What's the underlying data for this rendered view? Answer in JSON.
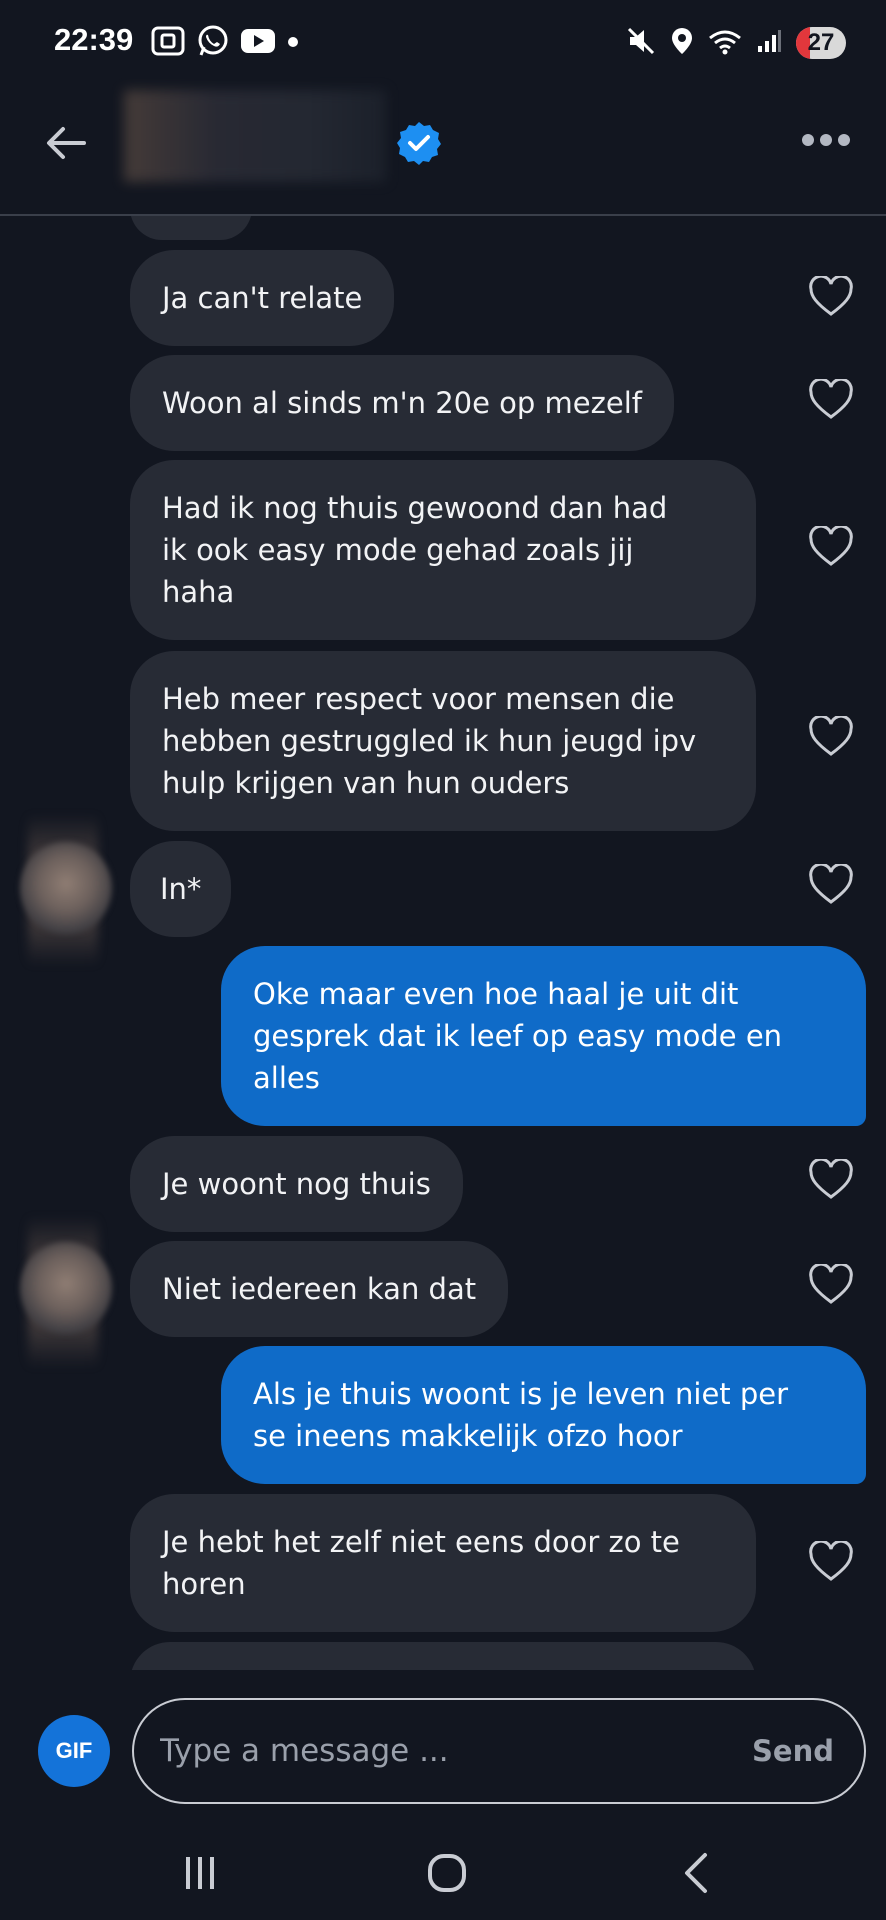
{
  "status_bar": {
    "time": "22:39",
    "battery": "27",
    "left_icons": [
      "screenshot-icon",
      "whatsapp-icon",
      "youtube-icon",
      "dot-icon"
    ],
    "right_icons": [
      "mute-icon",
      "location-icon",
      "wifi-icon",
      "signal-icon"
    ]
  },
  "header": {
    "contact_name": "",
    "verified": true,
    "icons": [
      "back-arrow-icon",
      "verified-badge-icon",
      "more-icon"
    ]
  },
  "messages": [
    {
      "id": "m1",
      "direction": "received",
      "text": "Ja can't relate",
      "liked": false
    },
    {
      "id": "m2",
      "direction": "received",
      "text": "Woon al sinds m'n 20e op mezelf",
      "liked": false
    },
    {
      "id": "m3",
      "direction": "received",
      "text": "Had ik nog thuis gewoond dan had\nik ook easy mode gehad zoals jij\nhaha",
      "liked": false
    },
    {
      "id": "m4",
      "direction": "received",
      "text": "Heb meer respect voor mensen die\nhebben gestruggled ik hun jeugd ipv\nhulp krijgen van hun ouders",
      "liked": false
    },
    {
      "id": "m5",
      "direction": "received",
      "text": "In*",
      "liked": false
    },
    {
      "id": "m6",
      "direction": "sent",
      "text": "Oke maar even hoe haal je uit dit\ngesprek dat ik leef op easy mode en\nalles"
    },
    {
      "id": "m7",
      "direction": "received",
      "text": "Je woont nog thuis",
      "liked": false
    },
    {
      "id": "m8",
      "direction": "received",
      "text": "Niet iedereen kan dat",
      "liked": false
    },
    {
      "id": "m9",
      "direction": "sent",
      "text": "Als je thuis woont is je leven niet per\nse ineens makkelijk ofzo hoor"
    },
    {
      "id": "m10",
      "direction": "received",
      "text": "Je hebt het zelf niet eens door zo te\nhoren",
      "liked": false
    }
  ],
  "composer": {
    "gif_label": "GIF",
    "placeholder": "Type a message ...",
    "value": "",
    "send_label": "Send"
  },
  "nav": {
    "icons": [
      "recent-apps-icon",
      "home-icon",
      "back-nav-icon"
    ]
  },
  "colors": {
    "background": "#121620",
    "received_bubble": "#272b35",
    "sent_bubble": "#0f6bc8",
    "accent": "#1473d9"
  }
}
